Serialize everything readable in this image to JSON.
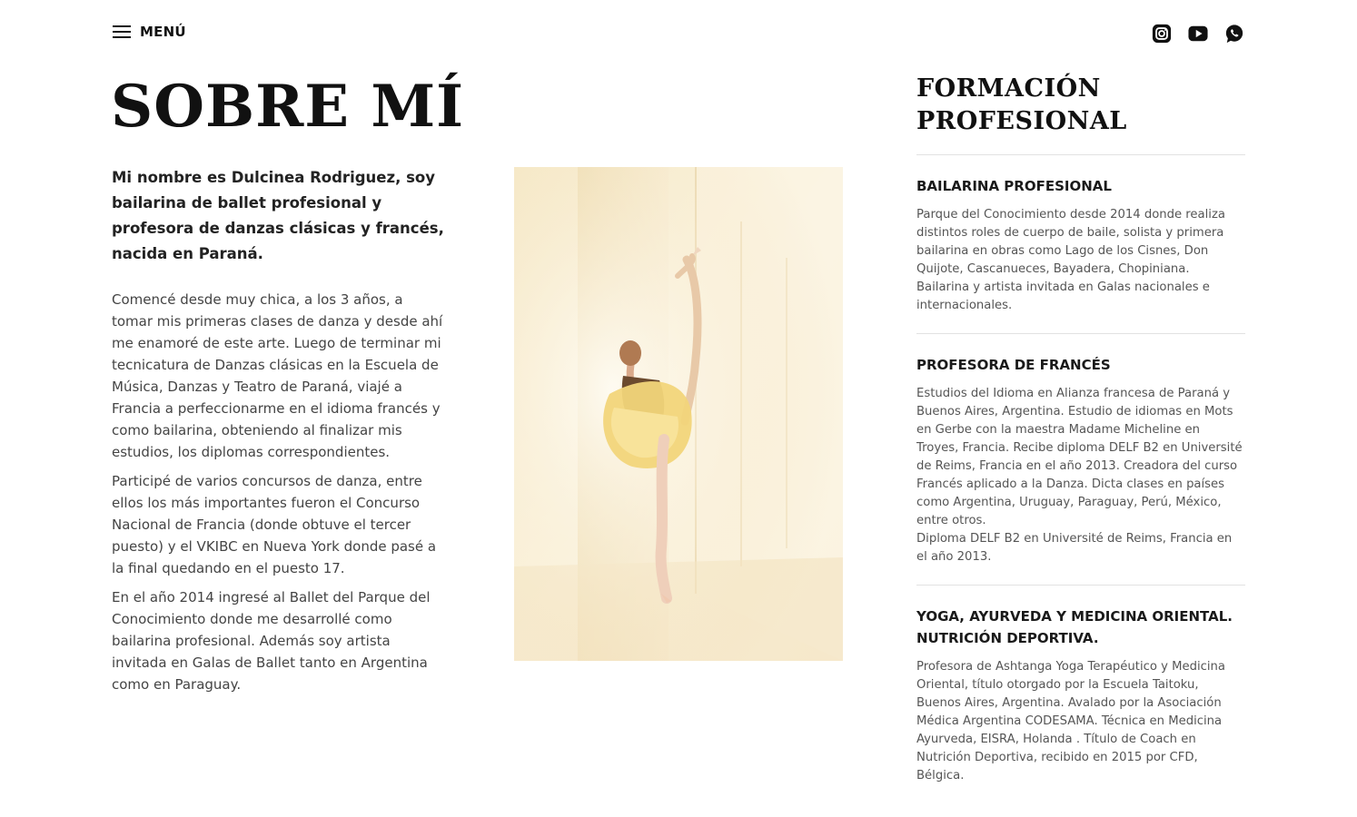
{
  "header": {
    "menu_label": "MENÚ",
    "social": [
      "instagram-icon",
      "youtube-icon",
      "whatsapp-icon"
    ]
  },
  "about": {
    "title": "SOBRE MÍ",
    "intro": "Mi nombre es Dulcinea Rodriguez, soy bailarina de ballet profesional y profesora de danzas clásicas y francés, nacida en Paraná.",
    "paragraphs": [
      "Comencé desde muy chica, a los 3 años, a tomar mis primeras clases de danza y desde ahí me enamoré de este arte. Luego de terminar mi tecnicatura de Danzas clásicas en la Escuela de Música, Danzas y Teatro de Paraná, viajé a Francia a perfeccionarme en el idioma francés y como bailarina, obteniendo al finalizar mis estudios, los diplomas correspondientes.",
      "Participé de varios concursos de danza, entre ellos los más importantes fueron el Concurso Nacional de Francia (donde obtuve el tercer puesto) y el VKIBC en Nueva York donde pasé a la final quedando en el puesto 17.",
      "En el año 2014 ingresé al Ballet del Parque del Conocimiento donde me desarrollé como bailarina profesional. Además soy artista invitada en Galas de Ballet tanto en Argentina como en Paraguay."
    ]
  },
  "formacion": {
    "title_line1": "FORMACIÓN",
    "title_line2": "PROFESIONAL",
    "items": [
      {
        "title": "BAILARINA PROFESIONAL",
        "text": "Parque del Conocimiento desde 2014 donde realiza distintos roles de cuerpo de baile, solista y primera bailarina en obras como Lago de los Cisnes, Don Quijote, Cascanueces, Bayadera, Chopiniana. Bailarina y artista invitada en Galas nacionales e internacionales."
      },
      {
        "title": "PROFESORA DE FRANCÉS",
        "text": "Estudios del Idioma en Alianza francesa de Paraná y Buenos Aires, Argentina. Estudio de idiomas en Mots en Gerbe con la maestra Madame Micheline en Troyes, Francia. Recibe diploma DELF B2 en Université de Reims, Francia en el año 2013. Creadora del curso Francés aplicado a la Danza. Dicta clases en países como Argentina, Uruguay, Paraguay, Perú, México, entre otros.\nDiploma DELF B2 en Université de Reims, Francia en el año 2013."
      },
      {
        "title": "YOGA, AYURVEDA Y MEDICINA ORIENTAL. NUTRICIÓN DEPORTIVA.",
        "text": "Profesora de Ashtanga Yoga Terapéutico y Medicina Oriental, título otorgado por la Escuela Taitoku, Buenos Aires, Argentina. Avalado por la Asociación Médica Argentina CODESAMA. Técnica en Medicina Ayurveda, EISRA, Holanda . Título de Coach en Nutrición Deportiva, recibido en 2015 por CFD, Bélgica."
      }
    ]
  }
}
